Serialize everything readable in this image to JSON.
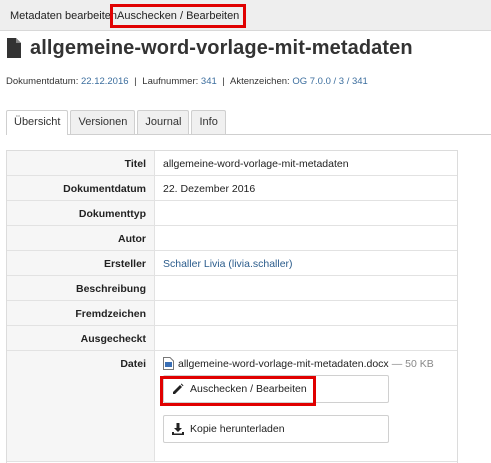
{
  "toolbar": {
    "edit_metadata_label": "Metadaten bearbeiten",
    "checkout_edit_label": "Auschecken / Bearbeiten"
  },
  "header": {
    "title": "allgemeine-word-vorlage-mit-metadaten",
    "icon": "document-icon"
  },
  "meta": {
    "date_label": "Dokumentdatum:",
    "date_value": "22.12.2016",
    "number_label": "Laufnummer:",
    "number_value": "341",
    "reference_label": "Aktenzeichen:",
    "reference_value": "OG 7.0.0 / 3 / 341"
  },
  "tabs": [
    {
      "label": "Übersicht",
      "active": true
    },
    {
      "label": "Versionen",
      "active": false
    },
    {
      "label": "Journal",
      "active": false
    },
    {
      "label": "Info",
      "active": false
    }
  ],
  "fields": {
    "title_label": "Titel",
    "title_value": "allgemeine-word-vorlage-mit-metadaten",
    "date_label": "Dokumentdatum",
    "date_value": "22. Dezember 2016",
    "type_label": "Dokumenttyp",
    "type_value": "",
    "author_label": "Autor",
    "author_value": "",
    "creator_label": "Ersteller",
    "creator_value": "Schaller Livia (livia.schaller)",
    "description_label": "Beschreibung",
    "description_value": "",
    "foreign_ref_label": "Fremdzeichen",
    "foreign_ref_value": "",
    "checked_out_label": "Ausgecheckt",
    "checked_out_value": "",
    "file_label": "Datei",
    "file_name": "allgemeine-word-vorlage-mit-metadaten.docx",
    "file_size": "— 50 KB"
  },
  "actions": {
    "checkout_edit_label": "Auschecken / Bearbeiten",
    "download_copy_label": "Kopie herunterladen"
  },
  "colors": {
    "highlight": "#e00000",
    "link": "#2b5c8c",
    "meta_value": "#3c6e9e"
  }
}
